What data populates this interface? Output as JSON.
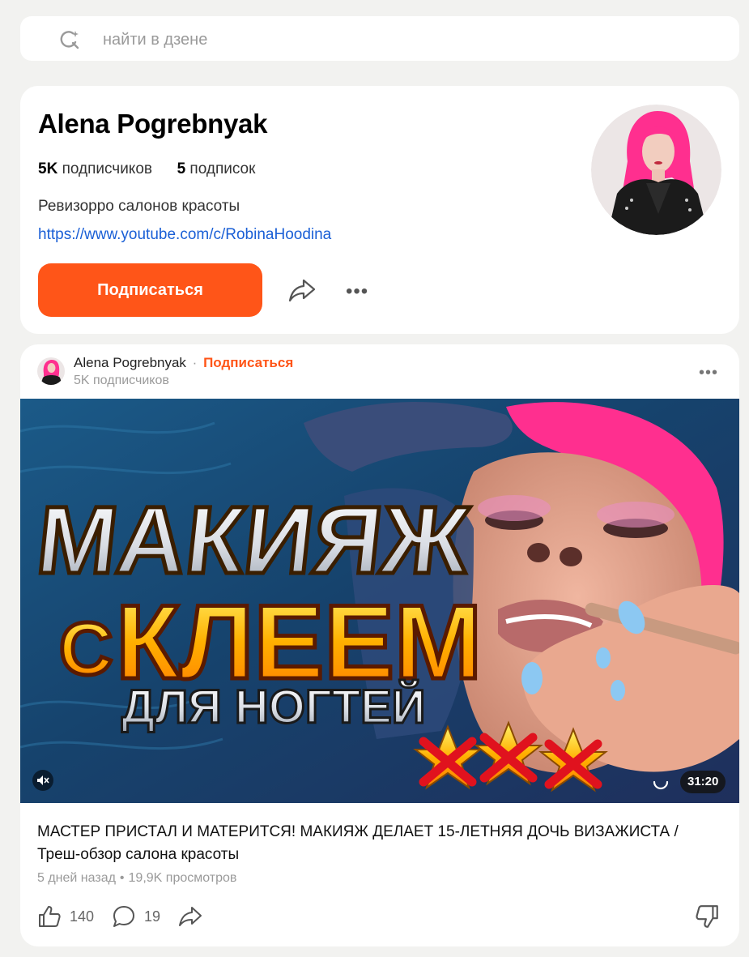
{
  "search": {
    "placeholder": "найти в дзене"
  },
  "profile": {
    "name": "Alena Pogrebnyak",
    "subscribers_count": "5K",
    "subscribers_label": "подписчиков",
    "subscriptions_count": "5",
    "subscriptions_label": "подписок",
    "description": "Ревизорро салонов красоты",
    "link": "https://www.youtube.com/c/RobinaHoodina",
    "subscribe_label": "Подписаться"
  },
  "post": {
    "author": "Alena Pogrebnyak",
    "separator": "·",
    "follow_label": "Подписаться",
    "subscribers": "5K подписчиков",
    "thumbnail_text": {
      "line1": "МАКИЯЖ",
      "line2a": "С",
      "line2b": "КЛЕЕМ",
      "line3": "ДЛЯ НОГТЕЙ"
    },
    "duration": "31:20",
    "title": "МАСТЕР ПРИСТАЛ И МАТЕРИТСЯ! МАКИЯЖ ДЕЛАЕТ 15-ЛЕТНЯЯ ДОЧЬ ВИЗАЖИСТА / Треш-обзор салона красоты",
    "age": "5 дней назад",
    "dot": "•",
    "views": "19,9K просмотров",
    "likes": "140",
    "comments": "19"
  },
  "colors": {
    "accent": "#ff5518",
    "link": "#1a5fd6",
    "background": "#f2f2f0"
  }
}
